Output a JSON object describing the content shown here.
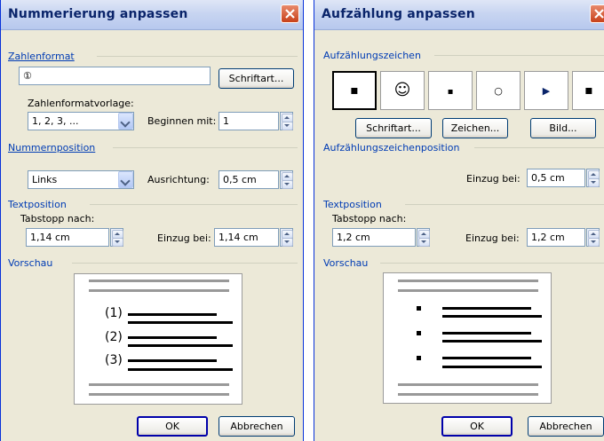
{
  "left_dialog": {
    "title": "Nummerierung anpassen",
    "zahlenformat_label": "Zahlenformat",
    "zahlenformat_value": "①",
    "schriftart_button": "Schriftart...",
    "vorlage_label": "Zahlenformatvorlage:",
    "vorlage_value": "1, 2, 3, ...",
    "beginnen_label": "Beginnen mit:",
    "beginnen_value": "1",
    "nummernposition_label": "Nummernposition",
    "position_value": "Links",
    "ausrichtung_label": "Ausrichtung:",
    "ausrichtung_value": "0,5 cm",
    "textposition_label": "Textposition",
    "tabstopp_label": "Tabstopp nach:",
    "tabstopp_value": "1,14 cm",
    "einzug_label": "Einzug bei:",
    "einzug_value": "1,14 cm",
    "vorschau_label": "Vorschau",
    "preview_numbers": [
      "(1)",
      "(2)",
      "(3)"
    ],
    "ok_button": "OK",
    "cancel_button": "Abbrechen"
  },
  "right_dialog": {
    "title": "Aufzählung anpassen",
    "zeichen_label": "Aufzählungszeichen",
    "bullets": [
      "▪",
      "☺",
      "▪",
      "○",
      "▶",
      "▪"
    ],
    "schriftart_button": "Schriftart...",
    "zeichen_button": "Zeichen...",
    "bild_button": "Bild...",
    "position_label": "Aufzählungszeichenposition",
    "einzug_label": "Einzug bei:",
    "einzug_value": "0,5 cm",
    "textposition_label": "Textposition",
    "tabstopp_label": "Tabstopp nach:",
    "tabstopp_value": "1,2 cm",
    "text_einzug_label": "Einzug bei:",
    "text_einzug_value": "1,2 cm",
    "vorschau_label": "Vorschau",
    "ok_button": "OK",
    "cancel_button": "Abbrechen"
  },
  "colors": {
    "title_text": "#0a246a",
    "section_text": "#003cb4",
    "dialog_bg": "#ece9d8",
    "close_red": "#c8411b"
  },
  "icons": [
    "close-icon",
    "dropdown-arrow-icon",
    "spin-up-icon",
    "spin-down-icon"
  ]
}
